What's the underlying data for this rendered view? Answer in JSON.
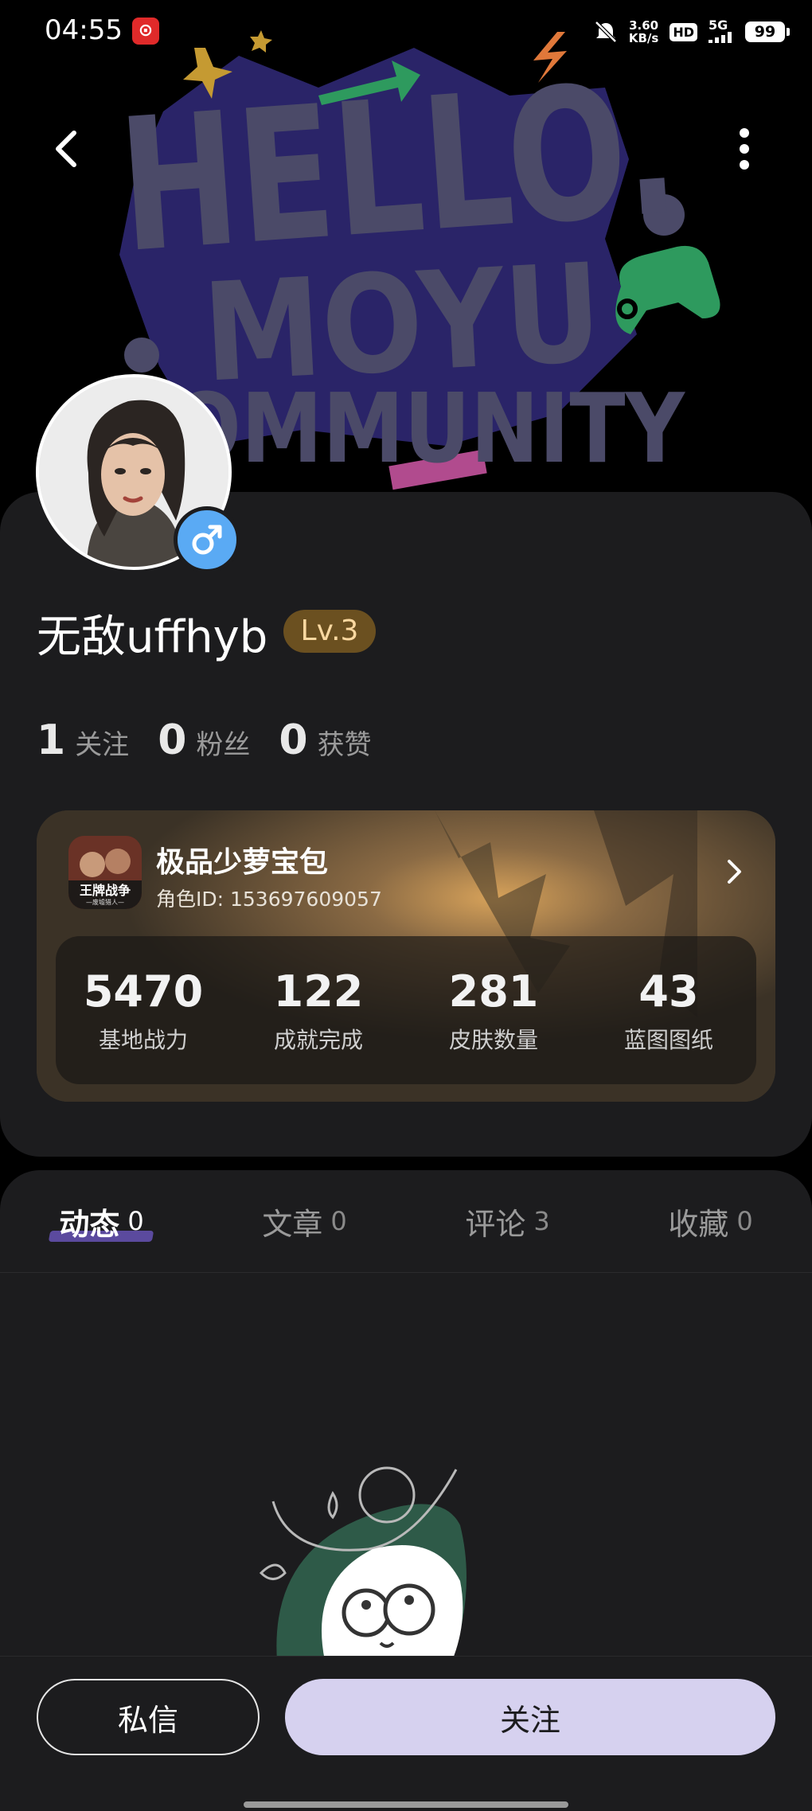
{
  "status_bar": {
    "time": "04:55",
    "app_icon": "netease-cloud-music-icon",
    "speed_value": "3.60",
    "speed_unit": "KB/s",
    "hd": "HD",
    "network": "5G",
    "battery": "99"
  },
  "banner": {
    "line1": "HELLO.",
    "line2": "MOYU",
    "line3": "COMMUNITY"
  },
  "profile": {
    "username": "无敌uffhyb",
    "level": "Lv.3",
    "gender_icon": "male-icon"
  },
  "stats": [
    {
      "num": "1",
      "label": "关注"
    },
    {
      "num": "0",
      "label": "粉丝"
    },
    {
      "num": "0",
      "label": "获赞"
    }
  ],
  "game_card": {
    "icon_text": "王牌战争",
    "icon_subtext": "—废墟猎人—",
    "name": "极品少萝宝包",
    "role_id": "角色ID: 153697609057",
    "stats": [
      {
        "value": "5470",
        "label": "基地战力"
      },
      {
        "value": "122",
        "label": "成就完成"
      },
      {
        "value": "281",
        "label": "皮肤数量"
      },
      {
        "value": "43",
        "label": "蓝图图纸"
      }
    ]
  },
  "tabs": [
    {
      "label": "动态",
      "count": "0",
      "active": true
    },
    {
      "label": "文章",
      "count": "0"
    },
    {
      "label": "评论",
      "count": "3"
    },
    {
      "label": "收藏",
      "count": "0"
    }
  ],
  "bottom": {
    "message_label": "私信",
    "follow_label": "关注"
  },
  "colors": {
    "background": "#000000",
    "card": "#1c1c1e",
    "level_badge": "#6b5020",
    "follow_button": "#d6d1ef",
    "tab_underline": "#5b4a9e",
    "gender_badge": "#5aaaf4"
  }
}
